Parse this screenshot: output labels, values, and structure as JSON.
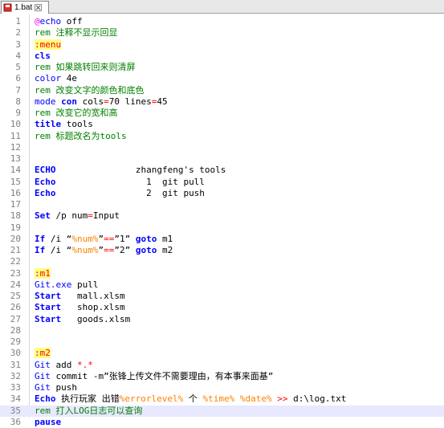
{
  "tab": {
    "label": "1.bat"
  },
  "lines": [
    {
      "n": "1",
      "tokens": [
        {
          "c": "t-at",
          "t": "@"
        },
        {
          "c": "t-kw",
          "t": "echo"
        },
        {
          "c": "t-txt",
          "t": " off"
        }
      ]
    },
    {
      "n": "2",
      "tokens": [
        {
          "c": "t-cmt",
          "t": "rem 注释不显示回显"
        }
      ]
    },
    {
      "n": "3",
      "tokens": [
        {
          "c": "t-label",
          "t": ":menu"
        }
      ]
    },
    {
      "n": "4",
      "tokens": [
        {
          "c": "t-cmd",
          "t": "cls"
        }
      ]
    },
    {
      "n": "5",
      "tokens": [
        {
          "c": "t-cmt",
          "t": "rem 如果跳转回来则清屏"
        }
      ]
    },
    {
      "n": "6",
      "tokens": [
        {
          "c": "t-kw",
          "t": "color"
        },
        {
          "c": "t-txt",
          "t": " 4e"
        }
      ]
    },
    {
      "n": "7",
      "tokens": [
        {
          "c": "t-cmt",
          "t": "rem 改变文字的颜色和底色"
        }
      ]
    },
    {
      "n": "8",
      "tokens": [
        {
          "c": "t-kw",
          "t": "mode"
        },
        {
          "c": "t-txt",
          "t": " "
        },
        {
          "c": "t-kwb",
          "t": "con"
        },
        {
          "c": "t-txt",
          "t": " cols"
        },
        {
          "c": "t-op",
          "t": "="
        },
        {
          "c": "t-txt",
          "t": "70 lines"
        },
        {
          "c": "t-op",
          "t": "="
        },
        {
          "c": "t-txt",
          "t": "45"
        }
      ]
    },
    {
      "n": "9",
      "tokens": [
        {
          "c": "t-cmt",
          "t": "rem 改变它的宽和高"
        }
      ]
    },
    {
      "n": "10",
      "tokens": [
        {
          "c": "t-cmd",
          "t": "title"
        },
        {
          "c": "t-txt",
          "t": " tools"
        }
      ]
    },
    {
      "n": "11",
      "tokens": [
        {
          "c": "t-cmt",
          "t": "rem 标题改名为tools"
        }
      ]
    },
    {
      "n": "12",
      "tokens": []
    },
    {
      "n": "13",
      "tokens": []
    },
    {
      "n": "14",
      "tokens": [
        {
          "c": "t-cmd",
          "t": "ECHO"
        },
        {
          "c": "t-txt",
          "t": "               zhangfeng's tools"
        }
      ]
    },
    {
      "n": "15",
      "tokens": [
        {
          "c": "t-cmd",
          "t": "Echo"
        },
        {
          "c": "t-txt",
          "t": "                 1  git pull"
        }
      ]
    },
    {
      "n": "16",
      "tokens": [
        {
          "c": "t-cmd",
          "t": "Echo"
        },
        {
          "c": "t-txt",
          "t": "                 2  git push"
        }
      ]
    },
    {
      "n": "17",
      "tokens": []
    },
    {
      "n": "18",
      "tokens": [
        {
          "c": "t-cmd",
          "t": "Set"
        },
        {
          "c": "t-txt",
          "t": " /p num"
        },
        {
          "c": "t-op",
          "t": "="
        },
        {
          "c": "t-txt",
          "t": "Input"
        }
      ]
    },
    {
      "n": "19",
      "tokens": []
    },
    {
      "n": "20",
      "tokens": [
        {
          "c": "t-cmd",
          "t": "If"
        },
        {
          "c": "t-txt",
          "t": " /i “"
        },
        {
          "c": "t-var",
          "t": "%num%"
        },
        {
          "c": "t-txt",
          "t": "”"
        },
        {
          "c": "t-op",
          "t": "=="
        },
        {
          "c": "t-txt",
          "t": "”1” "
        },
        {
          "c": "t-cmd",
          "t": "goto"
        },
        {
          "c": "t-txt",
          "t": " m1"
        }
      ]
    },
    {
      "n": "21",
      "tokens": [
        {
          "c": "t-cmd",
          "t": "If"
        },
        {
          "c": "t-txt",
          "t": " /i “"
        },
        {
          "c": "t-var",
          "t": "%num%"
        },
        {
          "c": "t-txt",
          "t": "”"
        },
        {
          "c": "t-op",
          "t": "=="
        },
        {
          "c": "t-txt",
          "t": "”2” "
        },
        {
          "c": "t-cmd",
          "t": "goto"
        },
        {
          "c": "t-txt",
          "t": " m2"
        }
      ]
    },
    {
      "n": "22",
      "tokens": []
    },
    {
      "n": "23",
      "tokens": [
        {
          "c": "t-label",
          "t": ":m1"
        }
      ]
    },
    {
      "n": "24",
      "tokens": [
        {
          "c": "t-kw",
          "t": "Git.exe"
        },
        {
          "c": "t-txt",
          "t": " pull"
        }
      ]
    },
    {
      "n": "25",
      "tokens": [
        {
          "c": "t-cmd",
          "t": "Start"
        },
        {
          "c": "t-txt",
          "t": "   mall.xlsm"
        }
      ]
    },
    {
      "n": "26",
      "tokens": [
        {
          "c": "t-cmd",
          "t": "Start"
        },
        {
          "c": "t-txt",
          "t": "   shop.xlsm"
        }
      ]
    },
    {
      "n": "27",
      "tokens": [
        {
          "c": "t-cmd",
          "t": "Start"
        },
        {
          "c": "t-txt",
          "t": "   goods.xlsm"
        }
      ]
    },
    {
      "n": "28",
      "tokens": []
    },
    {
      "n": "29",
      "tokens": []
    },
    {
      "n": "30",
      "tokens": [
        {
          "c": "t-label",
          "t": ":m2"
        }
      ]
    },
    {
      "n": "31",
      "tokens": [
        {
          "c": "t-kw",
          "t": "Git"
        },
        {
          "c": "t-txt",
          "t": " add "
        },
        {
          "c": "t-op",
          "t": "*.*"
        }
      ]
    },
    {
      "n": "32",
      "tokens": [
        {
          "c": "t-kw",
          "t": "Git"
        },
        {
          "c": "t-txt",
          "t": " commit -m”张锋上传文件不需要理由，有本事来面基”"
        }
      ]
    },
    {
      "n": "33",
      "tokens": [
        {
          "c": "t-kw",
          "t": "Git"
        },
        {
          "c": "t-txt",
          "t": " push"
        }
      ]
    },
    {
      "n": "34",
      "tokens": [
        {
          "c": "t-cmd",
          "t": "Echo"
        },
        {
          "c": "t-txt",
          "t": " 执行玩家 出错"
        },
        {
          "c": "t-var",
          "t": "%errorlevel%"
        },
        {
          "c": "t-txt",
          "t": " 个 "
        },
        {
          "c": "t-var",
          "t": "%time%"
        },
        {
          "c": "t-txt",
          "t": " "
        },
        {
          "c": "t-var",
          "t": "%date%"
        },
        {
          "c": "t-txt",
          "t": " "
        },
        {
          "c": "t-op",
          "t": ">>"
        },
        {
          "c": "t-txt",
          "t": " d:\\log.txt"
        }
      ]
    },
    {
      "n": "35",
      "tokens": [
        {
          "c": "t-cmt",
          "t": "rem 打入LOG日志可以查询"
        }
      ],
      "highlight": true
    },
    {
      "n": "36",
      "tokens": [
        {
          "c": "t-cmd",
          "t": "pause"
        }
      ]
    }
  ]
}
